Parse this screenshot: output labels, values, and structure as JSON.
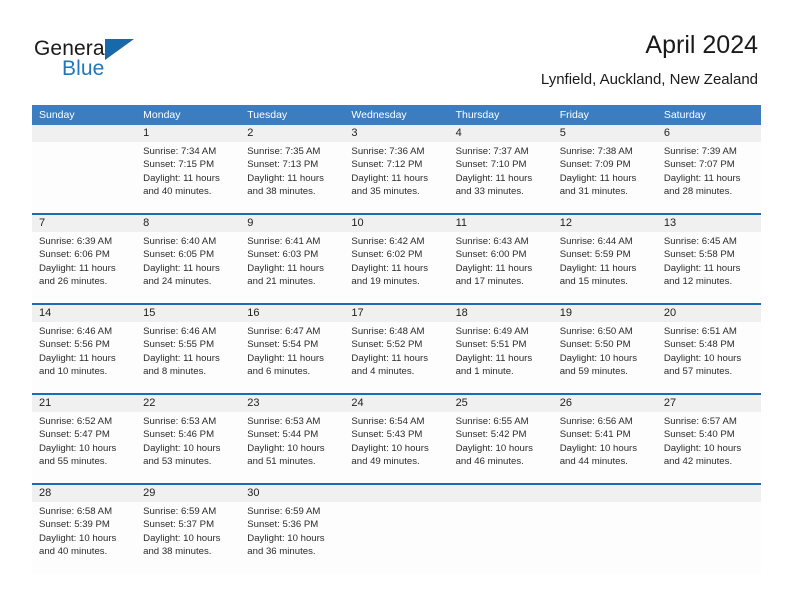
{
  "logo": {
    "word1": "General",
    "word2": "Blue",
    "triangle_icon": "blue-triangle-icon",
    "accent_color": "#1769aa",
    "text_color": "#2277bb"
  },
  "header": {
    "title": "April 2024",
    "subtitle": "Lynfield, Auckland, New Zealand"
  },
  "theme": {
    "header_blue": "#3b7dbf",
    "rule_blue": "#1d6cb3",
    "daynum_band": "#f0f0f0",
    "cell_bg": "#fdfdfd",
    "text": "#2b2b2b"
  },
  "weekdays": [
    "Sunday",
    "Monday",
    "Tuesday",
    "Wednesday",
    "Thursday",
    "Friday",
    "Saturday"
  ],
  "weeks": [
    {
      "days": [
        {
          "num": "",
          "l1": "",
          "l2": "",
          "l3": "",
          "l4": ""
        },
        {
          "num": "1",
          "l1": "Sunrise: 7:34 AM",
          "l2": "Sunset: 7:15 PM",
          "l3": "Daylight: 11 hours",
          "l4": "and 40 minutes."
        },
        {
          "num": "2",
          "l1": "Sunrise: 7:35 AM",
          "l2": "Sunset: 7:13 PM",
          "l3": "Daylight: 11 hours",
          "l4": "and 38 minutes."
        },
        {
          "num": "3",
          "l1": "Sunrise: 7:36 AM",
          "l2": "Sunset: 7:12 PM",
          "l3": "Daylight: 11 hours",
          "l4": "and 35 minutes."
        },
        {
          "num": "4",
          "l1": "Sunrise: 7:37 AM",
          "l2": "Sunset: 7:10 PM",
          "l3": "Daylight: 11 hours",
          "l4": "and 33 minutes."
        },
        {
          "num": "5",
          "l1": "Sunrise: 7:38 AM",
          "l2": "Sunset: 7:09 PM",
          "l3": "Daylight: 11 hours",
          "l4": "and 31 minutes."
        },
        {
          "num": "6",
          "l1": "Sunrise: 7:39 AM",
          "l2": "Sunset: 7:07 PM",
          "l3": "Daylight: 11 hours",
          "l4": "and 28 minutes."
        }
      ]
    },
    {
      "days": [
        {
          "num": "7",
          "l1": "Sunrise: 6:39 AM",
          "l2": "Sunset: 6:06 PM",
          "l3": "Daylight: 11 hours",
          "l4": "and 26 minutes."
        },
        {
          "num": "8",
          "l1": "Sunrise: 6:40 AM",
          "l2": "Sunset: 6:05 PM",
          "l3": "Daylight: 11 hours",
          "l4": "and 24 minutes."
        },
        {
          "num": "9",
          "l1": "Sunrise: 6:41 AM",
          "l2": "Sunset: 6:03 PM",
          "l3": "Daylight: 11 hours",
          "l4": "and 21 minutes."
        },
        {
          "num": "10",
          "l1": "Sunrise: 6:42 AM",
          "l2": "Sunset: 6:02 PM",
          "l3": "Daylight: 11 hours",
          "l4": "and 19 minutes."
        },
        {
          "num": "11",
          "l1": "Sunrise: 6:43 AM",
          "l2": "Sunset: 6:00 PM",
          "l3": "Daylight: 11 hours",
          "l4": "and 17 minutes."
        },
        {
          "num": "12",
          "l1": "Sunrise: 6:44 AM",
          "l2": "Sunset: 5:59 PM",
          "l3": "Daylight: 11 hours",
          "l4": "and 15 minutes."
        },
        {
          "num": "13",
          "l1": "Sunrise: 6:45 AM",
          "l2": "Sunset: 5:58 PM",
          "l3": "Daylight: 11 hours",
          "l4": "and 12 minutes."
        }
      ]
    },
    {
      "days": [
        {
          "num": "14",
          "l1": "Sunrise: 6:46 AM",
          "l2": "Sunset: 5:56 PM",
          "l3": "Daylight: 11 hours",
          "l4": "and 10 minutes."
        },
        {
          "num": "15",
          "l1": "Sunrise: 6:46 AM",
          "l2": "Sunset: 5:55 PM",
          "l3": "Daylight: 11 hours",
          "l4": "and 8 minutes."
        },
        {
          "num": "16",
          "l1": "Sunrise: 6:47 AM",
          "l2": "Sunset: 5:54 PM",
          "l3": "Daylight: 11 hours",
          "l4": "and 6 minutes."
        },
        {
          "num": "17",
          "l1": "Sunrise: 6:48 AM",
          "l2": "Sunset: 5:52 PM",
          "l3": "Daylight: 11 hours",
          "l4": "and 4 minutes."
        },
        {
          "num": "18",
          "l1": "Sunrise: 6:49 AM",
          "l2": "Sunset: 5:51 PM",
          "l3": "Daylight: 11 hours",
          "l4": "and 1 minute."
        },
        {
          "num": "19",
          "l1": "Sunrise: 6:50 AM",
          "l2": "Sunset: 5:50 PM",
          "l3": "Daylight: 10 hours",
          "l4": "and 59 minutes."
        },
        {
          "num": "20",
          "l1": "Sunrise: 6:51 AM",
          "l2": "Sunset: 5:48 PM",
          "l3": "Daylight: 10 hours",
          "l4": "and 57 minutes."
        }
      ]
    },
    {
      "days": [
        {
          "num": "21",
          "l1": "Sunrise: 6:52 AM",
          "l2": "Sunset: 5:47 PM",
          "l3": "Daylight: 10 hours",
          "l4": "and 55 minutes."
        },
        {
          "num": "22",
          "l1": "Sunrise: 6:53 AM",
          "l2": "Sunset: 5:46 PM",
          "l3": "Daylight: 10 hours",
          "l4": "and 53 minutes."
        },
        {
          "num": "23",
          "l1": "Sunrise: 6:53 AM",
          "l2": "Sunset: 5:44 PM",
          "l3": "Daylight: 10 hours",
          "l4": "and 51 minutes."
        },
        {
          "num": "24",
          "l1": "Sunrise: 6:54 AM",
          "l2": "Sunset: 5:43 PM",
          "l3": "Daylight: 10 hours",
          "l4": "and 49 minutes."
        },
        {
          "num": "25",
          "l1": "Sunrise: 6:55 AM",
          "l2": "Sunset: 5:42 PM",
          "l3": "Daylight: 10 hours",
          "l4": "and 46 minutes."
        },
        {
          "num": "26",
          "l1": "Sunrise: 6:56 AM",
          "l2": "Sunset: 5:41 PM",
          "l3": "Daylight: 10 hours",
          "l4": "and 44 minutes."
        },
        {
          "num": "27",
          "l1": "Sunrise: 6:57 AM",
          "l2": "Sunset: 5:40 PM",
          "l3": "Daylight: 10 hours",
          "l4": "and 42 minutes."
        }
      ]
    },
    {
      "days": [
        {
          "num": "28",
          "l1": "Sunrise: 6:58 AM",
          "l2": "Sunset: 5:39 PM",
          "l3": "Daylight: 10 hours",
          "l4": "and 40 minutes."
        },
        {
          "num": "29",
          "l1": "Sunrise: 6:59 AM",
          "l2": "Sunset: 5:37 PM",
          "l3": "Daylight: 10 hours",
          "l4": "and 38 minutes."
        },
        {
          "num": "30",
          "l1": "Sunrise: 6:59 AM",
          "l2": "Sunset: 5:36 PM",
          "l3": "Daylight: 10 hours",
          "l4": "and 36 minutes."
        },
        {
          "num": "",
          "l1": "",
          "l2": "",
          "l3": "",
          "l4": ""
        },
        {
          "num": "",
          "l1": "",
          "l2": "",
          "l3": "",
          "l4": ""
        },
        {
          "num": "",
          "l1": "",
          "l2": "",
          "l3": "",
          "l4": ""
        },
        {
          "num": "",
          "l1": "",
          "l2": "",
          "l3": "",
          "l4": ""
        }
      ]
    }
  ]
}
